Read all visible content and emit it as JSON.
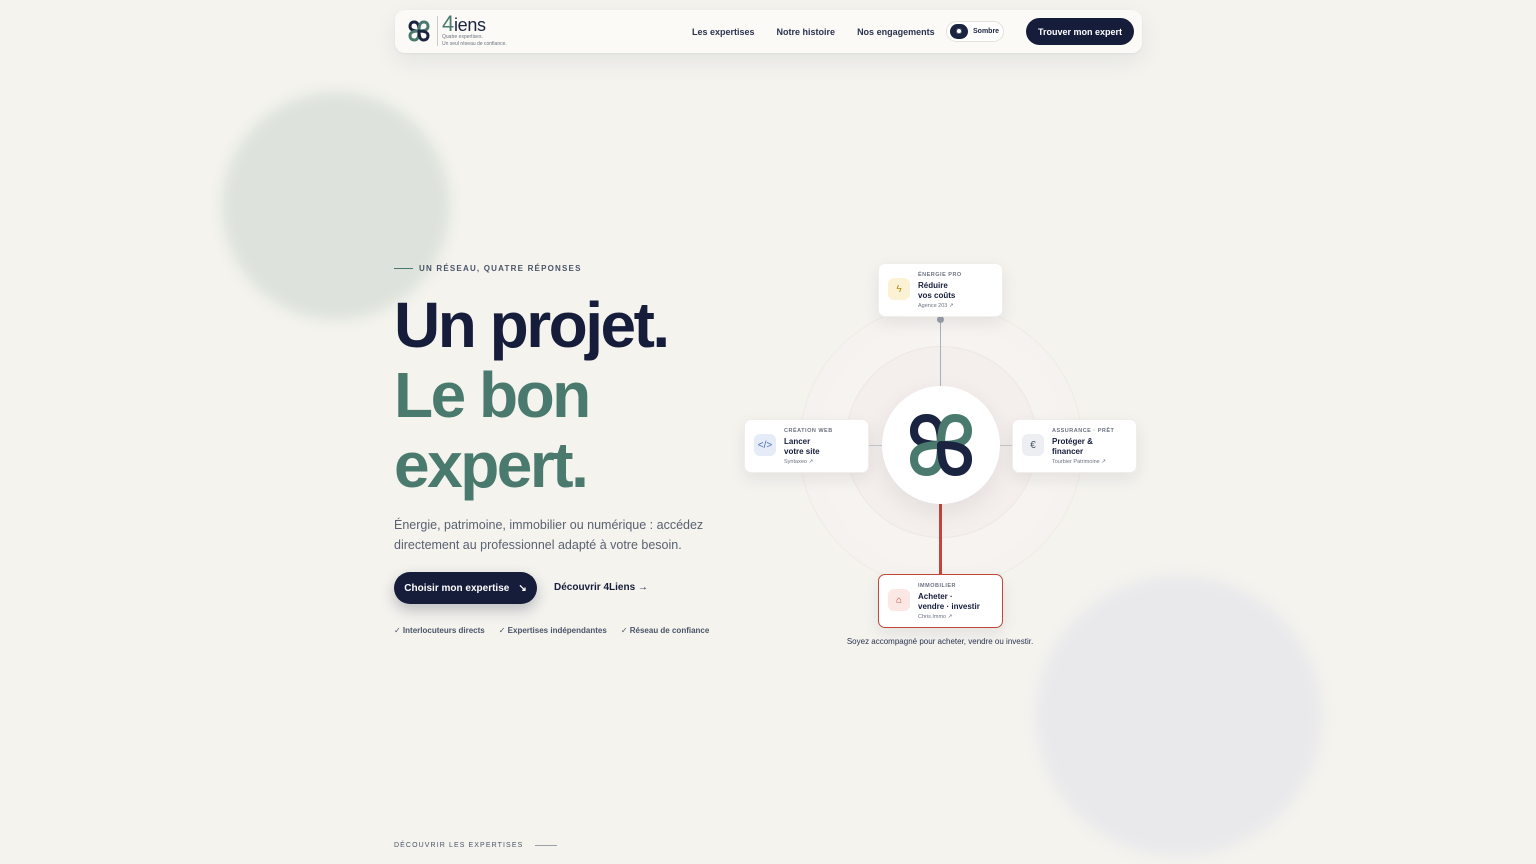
{
  "brand": {
    "name_prefix": "4",
    "name_suffix": "iens",
    "tagline_1": "Quatre expertises.",
    "tagline_2": "Un seul réseau de confiance."
  },
  "nav": {
    "links": [
      "Les expertises",
      "Notre histoire",
      "Nos engagements"
    ],
    "theme_toggle_label": "Sombre",
    "cta_label": "Trouver mon expert"
  },
  "hero": {
    "eyebrow": "UN RÉSEAU, QUATRE RÉPONSES",
    "headline_1": "Un projet.",
    "headline_2": "Le bon",
    "headline_3": "expert.",
    "lead": "Énergie, patrimoine, immobilier ou numérique : accédez directement au professionnel adapté à votre besoin.",
    "primary_cta": "Choisir mon expertise",
    "primary_cta_icon": "↘",
    "secondary_cta": "Découvrir 4Liens →",
    "checks": [
      "✓ Interlocuteurs directs",
      "✓ Expertises indépendantes",
      "✓ Réseau de confiance"
    ]
  },
  "diagram": {
    "cards": [
      {
        "tag": "ÉNERGIE PRO",
        "title": "Réduire\nvos coûts",
        "partner": "Agence 203 ↗",
        "icon": "bolt-icon",
        "glyph": "ϟ",
        "icon_bg": "#fbf2d6",
        "icon_color": "#b8860b"
      },
      {
        "tag": "CRÉATION WEB",
        "title": "Lancer\nvotre site",
        "partner": "Syntaxeo ↗",
        "icon": "code-icon",
        "glyph": "</>",
        "icon_bg": "#e6ecf7",
        "icon_color": "#4a6fb0"
      },
      {
        "tag": "ASSURANCE · PRÊT",
        "title": "Protéger &\nfinancer",
        "partner": "Tourbier Patrimoine ↗",
        "icon": "euro-icon",
        "glyph": "€",
        "icon_bg": "#eceef2",
        "icon_color": "#4a5568"
      },
      {
        "tag": "IMMOBILIER",
        "title": "Acheter ·\nvendre · investir",
        "partner": "Chris.Immo ↗",
        "icon": "home-icon",
        "glyph": "⌂",
        "icon_bg": "#fbe7e3",
        "icon_color": "#c0473a"
      }
    ],
    "caption": "Soyez accompagné pour acheter, vendre ou investir."
  },
  "footer_hint": "DÉCOUVRIR LES EXPERTISES",
  "colors": {
    "navy": "#161d3a",
    "green": "#4a7a6d",
    "accent_red": "#c0473a",
    "background": "#f4f3ee"
  }
}
